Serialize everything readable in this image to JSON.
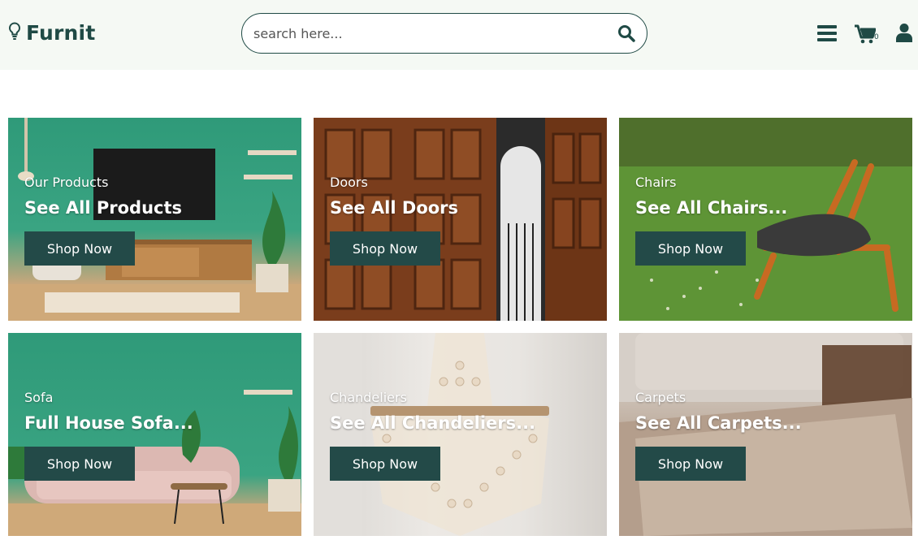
{
  "header": {
    "logo_text": "Furnit",
    "search_placeholder": "search here...",
    "cart_count": "0"
  },
  "colors": {
    "brand": "#1f4a45",
    "button": "#234a48",
    "topbar": "#f5f9f4"
  },
  "cards": [
    {
      "sub": "Our Products",
      "title": "See All Products",
      "button": "Shop Now"
    },
    {
      "sub": "Doors",
      "title": "See All Doors",
      "button": "Shop Now"
    },
    {
      "sub": "Chairs",
      "title": "See All Chairs...",
      "button": "Shop Now"
    },
    {
      "sub": "Sofa",
      "title": "Full House Sofa...",
      "button": "Shop Now"
    },
    {
      "sub": "Chandeliers",
      "title": "See All Chandeliers...",
      "button": "Shop Now"
    },
    {
      "sub": "Carpets",
      "title": "See All Carpets...",
      "button": "Shop Now"
    }
  ],
  "icons": {
    "logo": "lightbulb-icon",
    "search": "search-icon",
    "menu": "menu-icon",
    "cart": "cart-icon",
    "user": "user-icon"
  }
}
